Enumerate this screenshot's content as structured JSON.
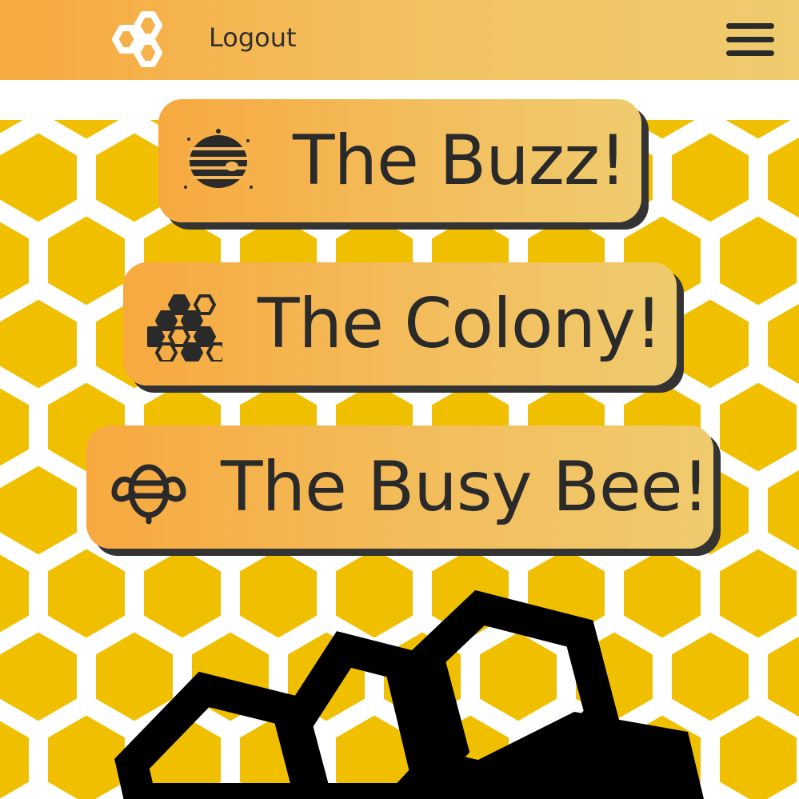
{
  "header": {
    "logout_label": "Logout",
    "logo_icon": "hexagon-cluster-icon",
    "menu_icon": "hamburger-menu-icon"
  },
  "nav": {
    "items": [
      {
        "label": "The Buzz!",
        "icon": "beehive-icon"
      },
      {
        "label": "The Colony!",
        "icon": "honeycomb-icon"
      },
      {
        "label": "The Busy Bee!",
        "icon": "bee-icon"
      }
    ]
  },
  "colors": {
    "header_gradient_start": "#f7a93f",
    "header_gradient_end": "#efcb6e",
    "honeycomb_fill": "#f0c000",
    "honeycomb_lines": "#ffffff",
    "text": "#2a2a2a",
    "shadow": "#333333"
  }
}
